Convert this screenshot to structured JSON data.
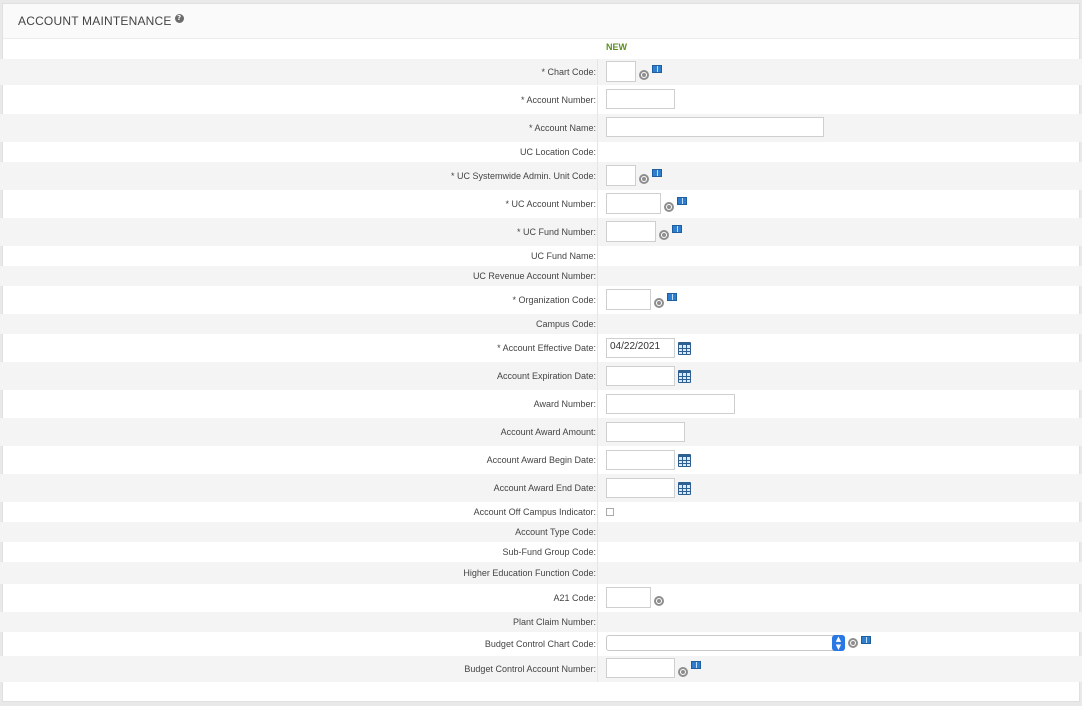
{
  "header": {
    "title": "ACCOUNT MAINTENANCE",
    "help_icon": "help-icon"
  },
  "status": "NEW",
  "fields": {
    "chart_code": {
      "label": "* Chart Code:"
    },
    "account_number": {
      "label": "* Account Number:"
    },
    "account_name": {
      "label": "* Account Name:"
    },
    "uc_location_code": {
      "label": "UC Location Code:"
    },
    "uc_systemwide_admin_unit_code": {
      "label": "* UC Systemwide Admin. Unit Code:"
    },
    "uc_account_number": {
      "label": "* UC Account Number:"
    },
    "uc_fund_number": {
      "label": "* UC Fund Number:"
    },
    "uc_fund_name": {
      "label": "UC Fund Name:"
    },
    "uc_revenue_account_number": {
      "label": "UC Revenue Account Number:"
    },
    "organization_code": {
      "label": "* Organization Code:"
    },
    "campus_code": {
      "label": "Campus Code:"
    },
    "account_effective_date": {
      "label": "* Account Effective Date:",
      "value": "04/22/2021"
    },
    "account_expiration_date": {
      "label": "Account Expiration Date:"
    },
    "award_number": {
      "label": "Award Number:"
    },
    "account_award_amount": {
      "label": "Account Award Amount:"
    },
    "account_award_begin_date": {
      "label": "Account Award Begin Date:"
    },
    "account_award_end_date": {
      "label": "Account Award End Date:"
    },
    "account_off_campus_indicator": {
      "label": "Account Off Campus Indicator:"
    },
    "account_type_code": {
      "label": "Account Type Code:"
    },
    "sub_fund_group_code": {
      "label": "Sub-Fund Group Code:"
    },
    "higher_education_function_code": {
      "label": "Higher Education Function Code:"
    },
    "a21_code": {
      "label": "A21 Code:"
    },
    "plant_claim_number": {
      "label": "Plant Claim Number:"
    },
    "budget_control_chart_code": {
      "label": "Budget Control Chart Code:"
    },
    "budget_control_account_number": {
      "label": "Budget Control Account Number:"
    }
  },
  "icons": {
    "search": "search-icon",
    "lookup": "book-icon",
    "calendar": "calendar-icon"
  }
}
